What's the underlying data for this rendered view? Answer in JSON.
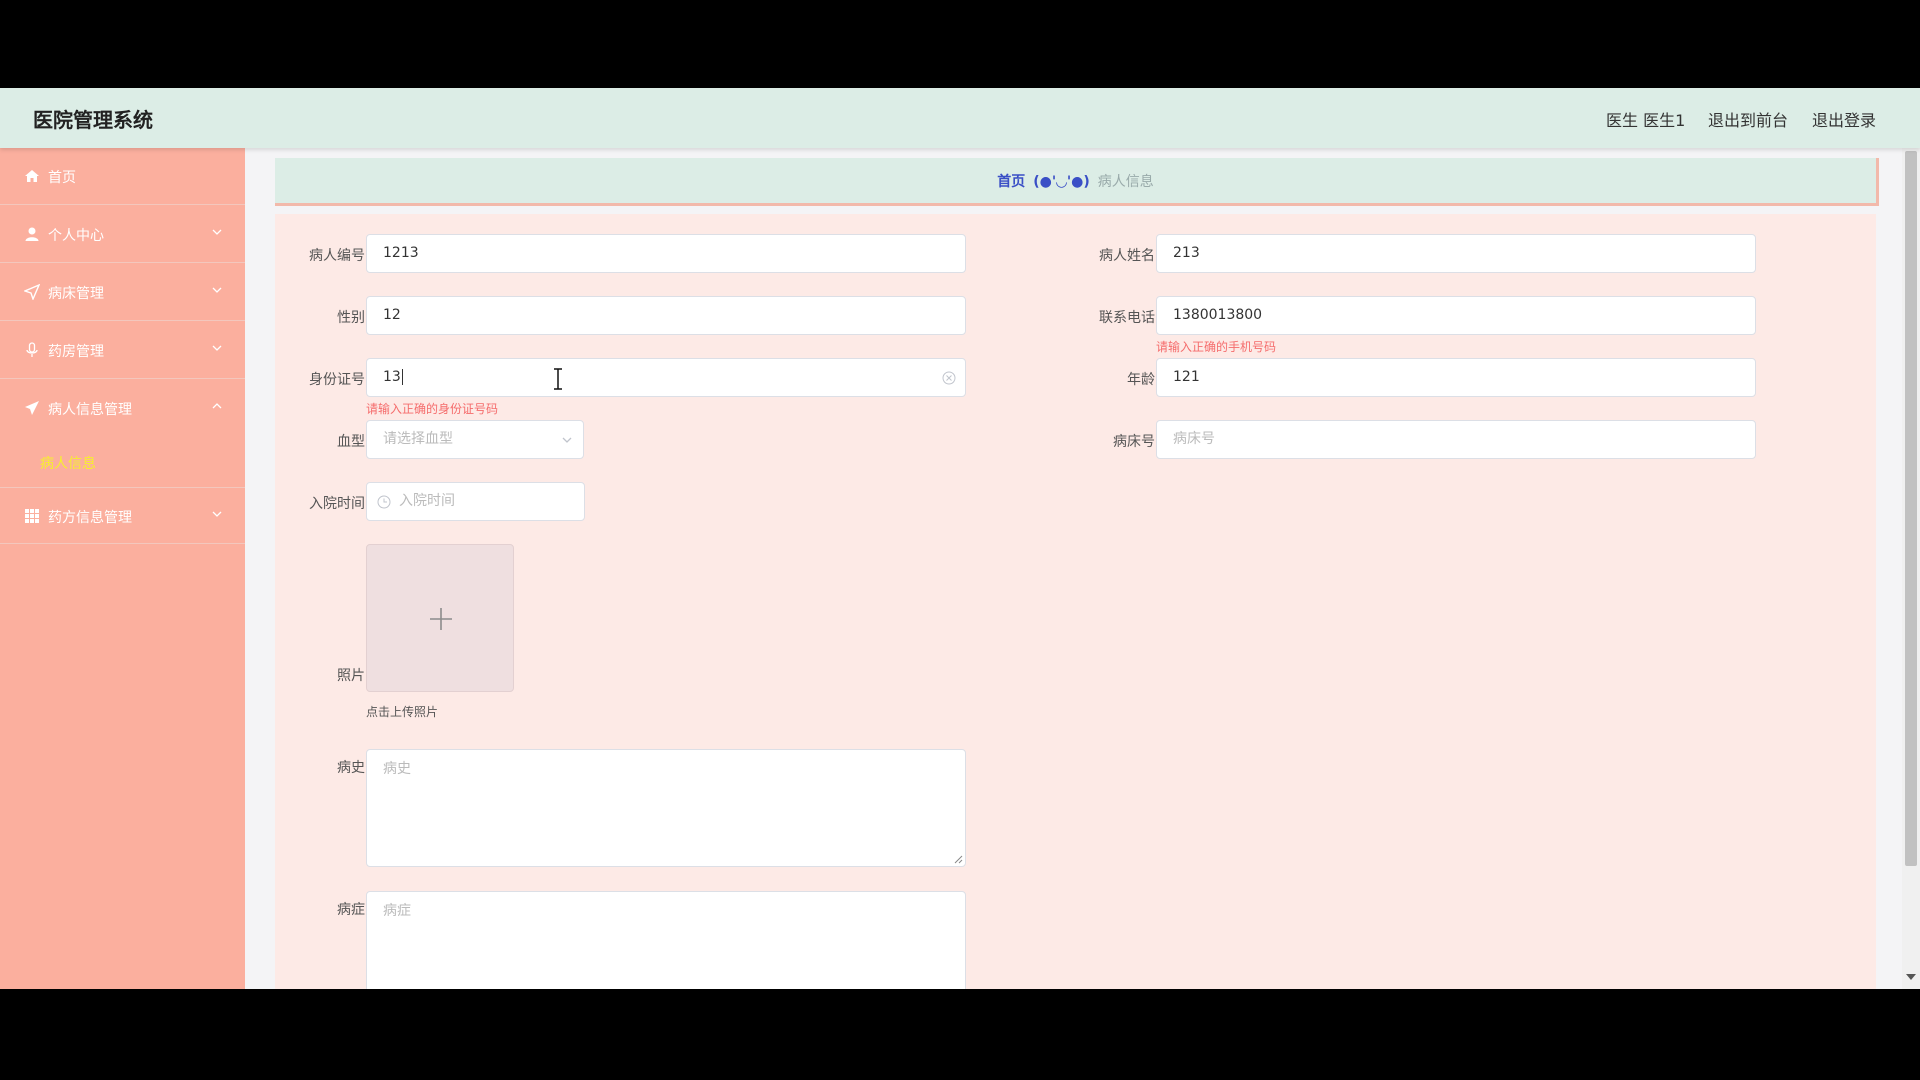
{
  "header": {
    "title": "医院管理系统",
    "user": "医生 医生1",
    "front_link": "退出到前台",
    "logout_link": "退出登录"
  },
  "sidebar": {
    "items": [
      {
        "label": "首页",
        "icon": "home-icon"
      },
      {
        "label": "个人中心",
        "icon": "user-icon"
      },
      {
        "label": "病床管理",
        "icon": "send-icon"
      },
      {
        "label": "药房管理",
        "icon": "microphone-icon"
      },
      {
        "label": "病人信息管理",
        "icon": "paper-plane-icon"
      },
      {
        "label": "药方信息管理",
        "icon": "grid-icon"
      }
    ],
    "submenu_active": "病人信息"
  },
  "breadcrumb": {
    "home": "首页",
    "separator": "(●'◡'●)",
    "current": "病人信息"
  },
  "form": {
    "patient_id": {
      "label": "病人编号",
      "value": "1213"
    },
    "patient_name": {
      "label": "病人姓名",
      "value": "213"
    },
    "gender": {
      "label": "性别",
      "value": "12"
    },
    "phone": {
      "label": "联系电话",
      "value": "1380013800",
      "error": "请输入正确的手机号码"
    },
    "id_card": {
      "label": "身份证号",
      "value": "13",
      "error": "请输入正确的身份证号码"
    },
    "age": {
      "label": "年龄",
      "value": "121"
    },
    "blood_type": {
      "label": "血型",
      "placeholder": "请选择血型"
    },
    "bed_no": {
      "label": "病床号",
      "placeholder": "病床号"
    },
    "admit_time": {
      "label": "入院时间",
      "placeholder": "入院时间"
    },
    "photo": {
      "label": "照片",
      "hint": "点击上传照片"
    },
    "history": {
      "label": "病史",
      "placeholder": "病史"
    },
    "symptoms": {
      "label": "病症",
      "placeholder": "病症"
    }
  },
  "colors": {
    "header_bg": "#dcede6",
    "sidebar_bg": "#fbaf9e",
    "form_bg": "#fdeae6",
    "error": "#f56c6c",
    "active_submenu": "#f7ef2e",
    "breadcrumb_home": "#3a4fc6"
  }
}
